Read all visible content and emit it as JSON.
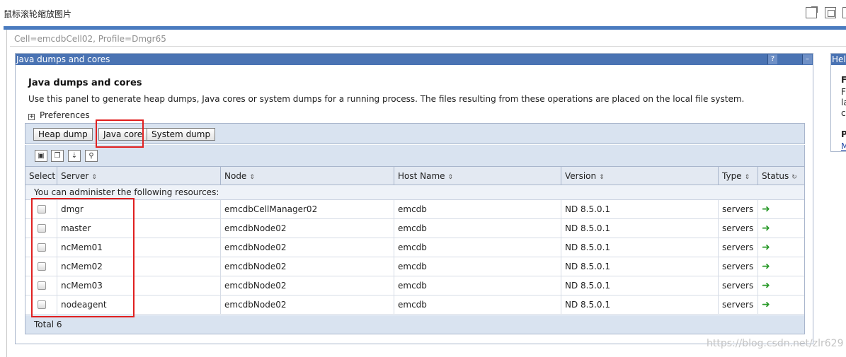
{
  "window": {
    "title": "鼠标滚轮缩放图片",
    "icons": [
      "open-external-icon",
      "maximize-icon",
      "close-icon"
    ]
  },
  "breadcrumb": "Cell=emcdbCell02, Profile=Dmgr65",
  "panel": {
    "header_title": "Java dumps and cores",
    "help_glyph": "?",
    "minimize_glyph": "–",
    "section_title": "Java dumps and cores",
    "description": "Use this panel to generate heap dumps, Java cores or system dumps for a running process. The files resulting from these operations are placed on the local file system.",
    "preferences_label": "Preferences",
    "preferences_toggle": "+"
  },
  "toolbar": {
    "heap_dump": "Heap dump",
    "java_core": "Java core",
    "system_dump": "System dump",
    "icons": [
      "select-all-icon",
      "deselect-all-icon",
      "expand-icon",
      "filter-icon"
    ]
  },
  "table": {
    "headers": {
      "select": "Select",
      "server": "Server",
      "node": "Node",
      "host": "Host Name",
      "version": "Version",
      "type": "Type",
      "status": "Status"
    },
    "sort_glyph": "⇕",
    "refresh_glyph": "↻",
    "info": "You can administer the following resources:",
    "rows": [
      {
        "server": "dmgr",
        "node": "emcdbCellManager02",
        "host": "emcdb",
        "version": "ND 8.5.0.1",
        "type": "servers"
      },
      {
        "server": "master",
        "node": "emcdbNode02",
        "host": "emcdb",
        "version": "ND 8.5.0.1",
        "type": "servers"
      },
      {
        "server": "ncMem01",
        "node": "emcdbNode02",
        "host": "emcdb",
        "version": "ND 8.5.0.1",
        "type": "servers"
      },
      {
        "server": "ncMem02",
        "node": "emcdbNode02",
        "host": "emcdb",
        "version": "ND 8.5.0.1",
        "type": "servers"
      },
      {
        "server": "ncMem03",
        "node": "emcdbNode02",
        "host": "emcdb",
        "version": "ND 8.5.0.1",
        "type": "servers"
      },
      {
        "server": "nodeagent",
        "node": "emcdbNode02",
        "host": "emcdb",
        "version": "ND 8.5.0.1",
        "type": "servers"
      }
    ],
    "status_glyph": "➜",
    "total": "Total 6"
  },
  "help_panel": {
    "title": "Hel",
    "lines": [
      "F",
      "F",
      "la",
      "cu",
      "P",
      "M"
    ]
  },
  "watermark": "https://blog.csdn.net/zlr629",
  "colors": {
    "header_blue": "#4a73b3",
    "toolbar_bg": "#d9e3f0",
    "highlight_red": "#e02020",
    "status_green": "#2a9a2a"
  }
}
